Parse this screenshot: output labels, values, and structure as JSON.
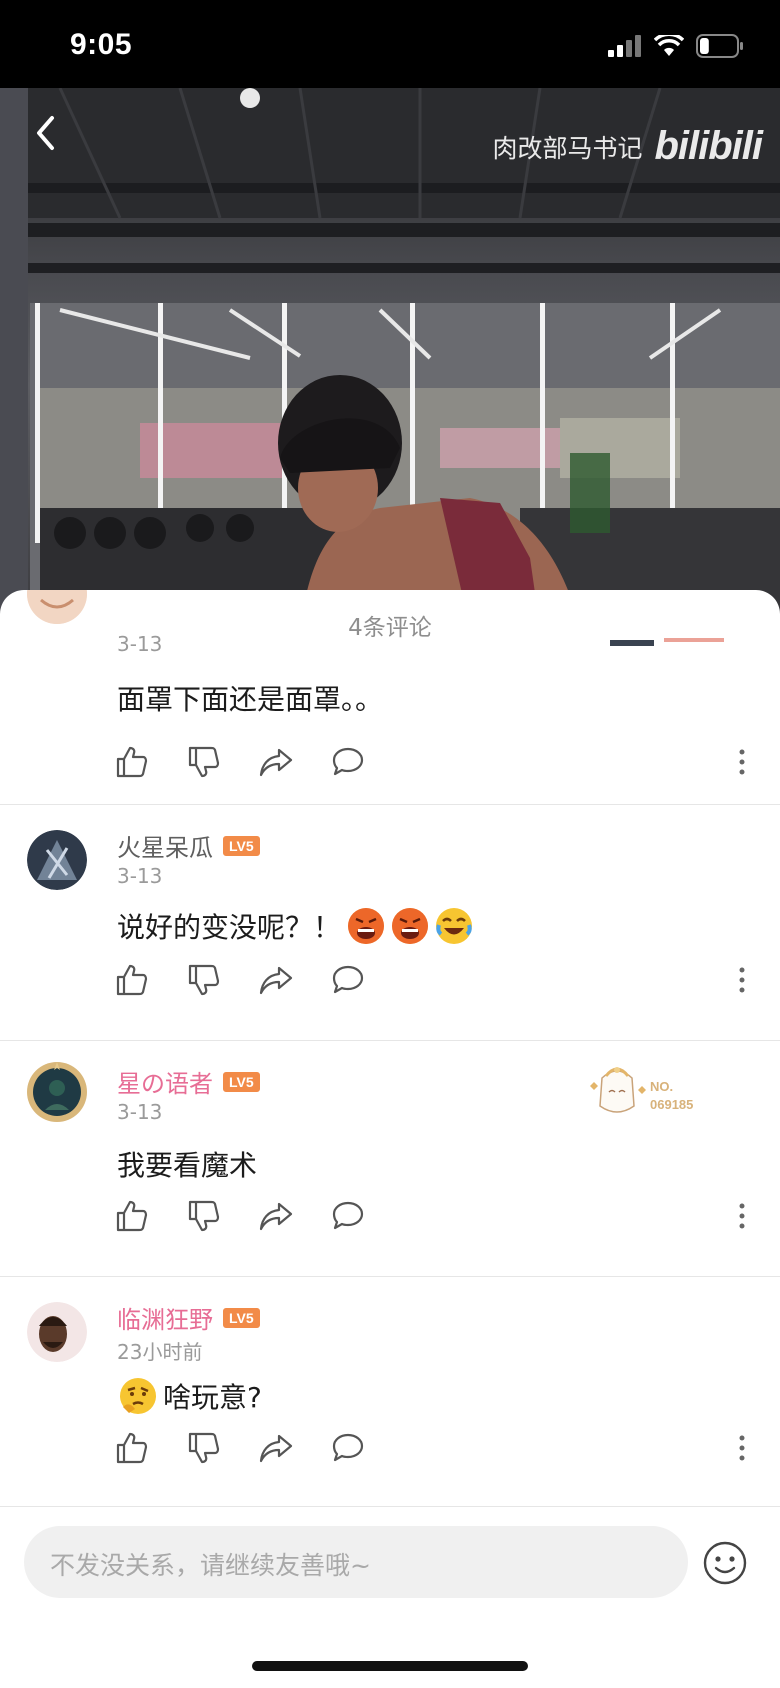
{
  "status_bar": {
    "time": "9:05",
    "battery_level": 0.25
  },
  "video": {
    "watermark_author": "肉改部马书记",
    "watermark_logo": "bilibili"
  },
  "comments_panel": {
    "title": "4条评论",
    "comments": [
      {
        "username": "",
        "level": "",
        "time": "3-13",
        "text": "面罩下面还是面罩。。"
      },
      {
        "username": "火星呆瓜",
        "level": "LV5",
        "time": "3-13",
        "text": "说好的变没呢？！",
        "emojis": [
          "angry-emoji",
          "angry-emoji",
          "laugh-cry-emoji"
        ]
      },
      {
        "username": "星の语者",
        "level": "LV5",
        "time": "3-13",
        "text": "我要看魔术",
        "badge_no_label": "NO.",
        "badge_no_number": "069185"
      },
      {
        "username": "临渊狂野",
        "level": "LV5",
        "time": "23小时前",
        "text": "啥玩意?",
        "emojis_before": [
          "thinking-emoji"
        ]
      }
    ]
  },
  "input": {
    "placeholder": "不发没关系，请继续友善哦~"
  },
  "colors": {
    "level_badge": "#f28b48",
    "vip_name": "#e76d95",
    "divider": "#e6e6e6"
  }
}
